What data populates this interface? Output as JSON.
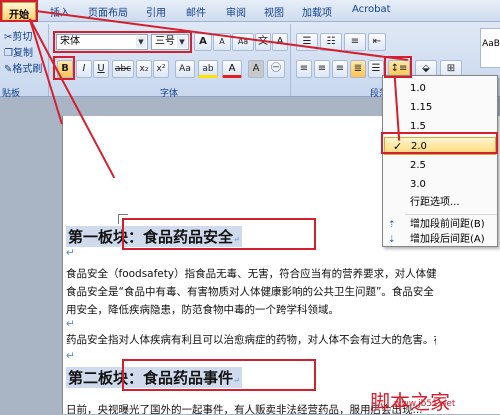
{
  "tabs": [
    "开始",
    "插入",
    "页面布局",
    "引用",
    "邮件",
    "审阅",
    "视图",
    "加载项",
    "Acrobat"
  ],
  "clipboard": {
    "cut": "剪切",
    "copy": "复制",
    "painter": "格式刷",
    "group": "贴板"
  },
  "font": {
    "name": "宋体",
    "size": "三号",
    "group": "字体",
    "bold": "B",
    "italic": "I",
    "underline": "U",
    "strike": "abc",
    "sub": "x₂",
    "super": "x²",
    "clear": "Aa",
    "grow": "A",
    "shrink": "A",
    "highlight": "ab",
    "color": "A",
    "charshade": "A",
    "border": "A"
  },
  "paragraph_group": "段落",
  "styles_preview": "AaB",
  "line_spacing_menu": {
    "items": [
      "1.0",
      "1.15",
      "1.5",
      "2.0",
      "2.5",
      "3.0"
    ],
    "selected": "2.0",
    "check": "✓",
    "options": "行距选项...",
    "add_before": "增加段前间距(B)",
    "add_after": "增加段后间距(A)"
  },
  "document": {
    "heading1": "第一板块：食品药品安全",
    "p1_line1": "食品安全（foodsafety）指食品无毒、无害，符合应当有的营养要求，对人体健康",
    "p1_line2": "食品安全是“食品中有毒、有害物质对人体健康影响的公共卫生问题”。食品安全",
    "p1_line3": "用安全，降低疾病隐患，防范食物中毒的一个跨学科领域。",
    "p2_line1": "药品安全指对人体疾病有利且可以治愈病症的药物，对人体不会有过大的危害。在",
    "heading2": "第二板块：食品药品事件",
    "p3_line1": "日前，央视曝光了国外的一起事件，有人贩卖非法经营药品，服用后会出现...",
    "para_mark": "↵"
  },
  "watermark": {
    "text": "脚本之家",
    "url": "www.jb51.net"
  },
  "colors": {
    "annotation": "#d2202e",
    "ribbon": "#dfe8f6",
    "highlight": "#ffd776"
  }
}
